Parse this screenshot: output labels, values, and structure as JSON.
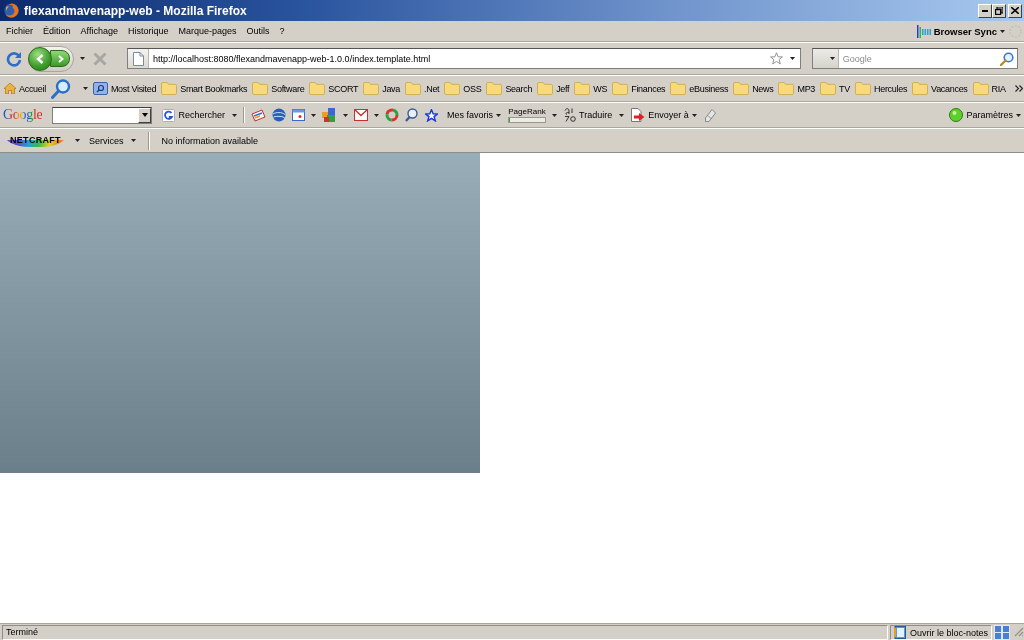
{
  "window": {
    "title": "flexandmavenapp-web - Mozilla Firefox"
  },
  "menu_bar": {
    "items": [
      "Fichier",
      "Édition",
      "Affichage",
      "Historique",
      "Marque-pages",
      "Outils",
      "?"
    ],
    "sync_label": "Browser Sync"
  },
  "nav_bar": {
    "stop": {
      "disabled": true
    },
    "url": "http://localhost:8080/flexandmavenapp-web-1.0.0/index.template.html",
    "search": {
      "placeholder": "Google"
    }
  },
  "bookmarks_bar": {
    "items": [
      {
        "kind": "home",
        "label": "Accueil"
      },
      {
        "kind": "search"
      },
      {
        "kind": "places",
        "label": "Most Visited"
      },
      {
        "kind": "folder",
        "label": "Smart Bookmarks"
      },
      {
        "kind": "folder",
        "label": "Software"
      },
      {
        "kind": "folder",
        "label": "SCORT"
      },
      {
        "kind": "folder",
        "label": "Java"
      },
      {
        "kind": "folder",
        "label": ".Net"
      },
      {
        "kind": "folder",
        "label": "OSS"
      },
      {
        "kind": "folder",
        "label": "Search"
      },
      {
        "kind": "folder",
        "label": "Jeff"
      },
      {
        "kind": "folder",
        "label": "WS"
      },
      {
        "kind": "folder",
        "label": "Finances"
      },
      {
        "kind": "folder",
        "label": "eBusiness"
      },
      {
        "kind": "folder",
        "label": "News"
      },
      {
        "kind": "folder",
        "label": "MP3"
      },
      {
        "kind": "folder",
        "label": "TV"
      },
      {
        "kind": "folder",
        "label": "Hercules"
      },
      {
        "kind": "folder",
        "label": "Vacances"
      },
      {
        "kind": "folder",
        "label": "RIA"
      }
    ]
  },
  "google_toolbar": {
    "logo": "Google",
    "search_button": "Rechercher",
    "favorites": "Mes favoris",
    "pagerank": {
      "label": "PageRank",
      "level": 0
    },
    "translate": "Traduire",
    "send": "Envoyer à",
    "settings": "Paramètres"
  },
  "netcraft_toolbar": {
    "logo": "NETCRAFT",
    "services": "Services",
    "info": "No information available"
  },
  "status_bar": {
    "text": "Terminé",
    "notepad": "Ouvrir le bloc-notes"
  }
}
